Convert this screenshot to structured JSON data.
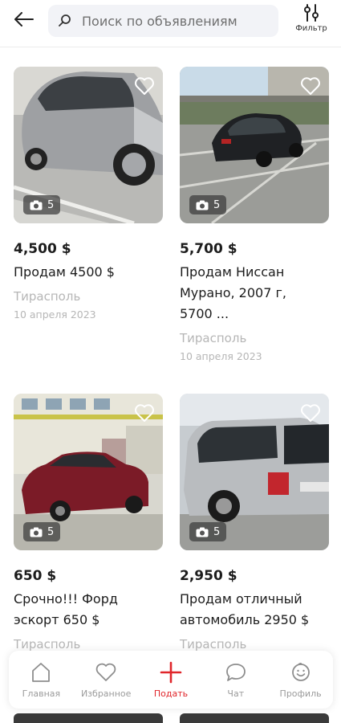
{
  "search": {
    "placeholder": "Поиск по объявлениям"
  },
  "filter": {
    "label": "Фильтр"
  },
  "listings": [
    {
      "price": "4,500 $",
      "title": "Продам 4500 $",
      "city": "Тирасполь",
      "date": "10 апреля 2023",
      "photos": "5"
    },
    {
      "price": "5,700 $",
      "title": "Продам Ниссан Мурано, 2007 г, 5700 ...",
      "city": "Тирасполь",
      "date": "10 апреля 2023",
      "photos": "5"
    },
    {
      "price": "650 $",
      "title": "Срочно!!! Форд эскорт 650 $",
      "city": "Тирасполь",
      "photos": "5"
    },
    {
      "price": "2,950 $",
      "title": "Продам отличный автомобиль 2950 $",
      "city": "Тирасполь",
      "photos": "5"
    }
  ],
  "nav": [
    {
      "label": "Главная",
      "icon": "home-icon"
    },
    {
      "label": "Избранное",
      "icon": "heart-icon"
    },
    {
      "label": "Подать",
      "icon": "plus-icon"
    },
    {
      "label": "Чат",
      "icon": "chat-icon"
    },
    {
      "label": "Профиль",
      "icon": "smiley-icon"
    }
  ],
  "colors": {
    "accent": "#e0262b",
    "muted": "#b6b6b6",
    "nav_text": "#9b9b9b"
  }
}
